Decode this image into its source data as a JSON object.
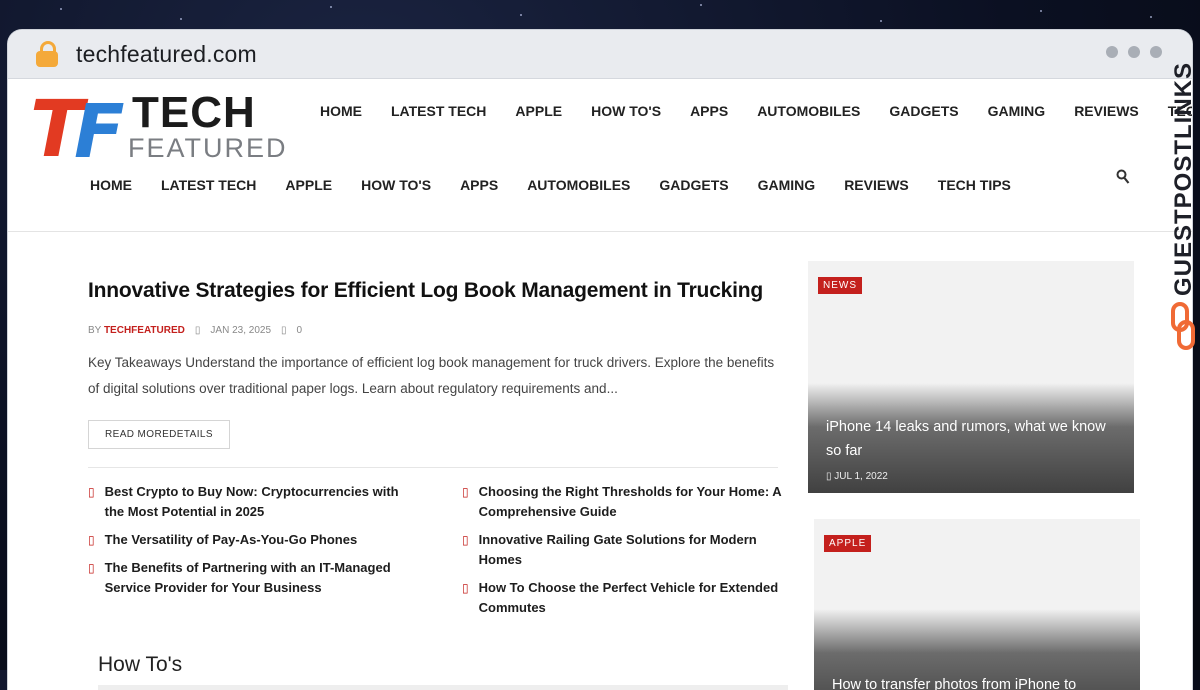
{
  "browser": {
    "url": "techfeatured.com"
  },
  "logo": {
    "word1": "TECH",
    "word2": "FEATURED",
    "mark_t": "T",
    "mark_f": "F"
  },
  "nav_top": [
    "HOME",
    "LATEST TECH",
    "APPLE",
    "HOW TO'S",
    "APPS",
    "AUTOMOBILES",
    "GADGETS",
    "GAMING",
    "REVIEWS",
    "TECH TIPS"
  ],
  "nav_main": [
    "HOME",
    "LATEST TECH",
    "APPLE",
    "HOW TO'S",
    "APPS",
    "AUTOMOBILES",
    "GADGETS",
    "GAMING",
    "REVIEWS",
    "TECH TIPS"
  ],
  "search_icon": "search-icon",
  "featured": {
    "title": "Innovative Strategies for Efficient Log Book Management in Trucking",
    "by": "BY",
    "author": "TECHFEATURED",
    "date": "JAN 23, 2025",
    "comments": "0",
    "excerpt": "Key Takeaways Understand the importance of efficient log book management for truck drivers. Explore the benefits of digital solutions over traditional paper logs. Learn about regulatory requirements and...",
    "read_more": "READ MOREDETAILS"
  },
  "related_left": [
    "Best Crypto to Buy Now: Cryptocurrencies with the Most Potential in 2025",
    "The Versatility of Pay-As-You-Go Phones",
    "The Benefits of Partnering with an IT-Managed Service Provider for Your Business"
  ],
  "related_right": [
    "Choosing the Right Thresholds for Your Home: A Comprehensive Guide",
    "Innovative Railing Gate Solutions for Modern Homes",
    "How To Choose the Perfect Vehicle for Extended Commutes"
  ],
  "section_heading": "How To's",
  "side_cards": [
    {
      "category": "NEWS",
      "title": "iPhone 14 leaks and rumors, what we know so far",
      "date": "JUL 1, 2022"
    },
    {
      "category": "APPLE",
      "title": "How to transfer photos from iPhone to Computer",
      "date": ""
    }
  ],
  "badge": {
    "text": "GUESTPOSTLINKS"
  },
  "colors": {
    "accent": "#c4201d",
    "logo_red": "#e23a22",
    "logo_blue": "#2c7fd6",
    "badge_orange": "#f06a35"
  }
}
